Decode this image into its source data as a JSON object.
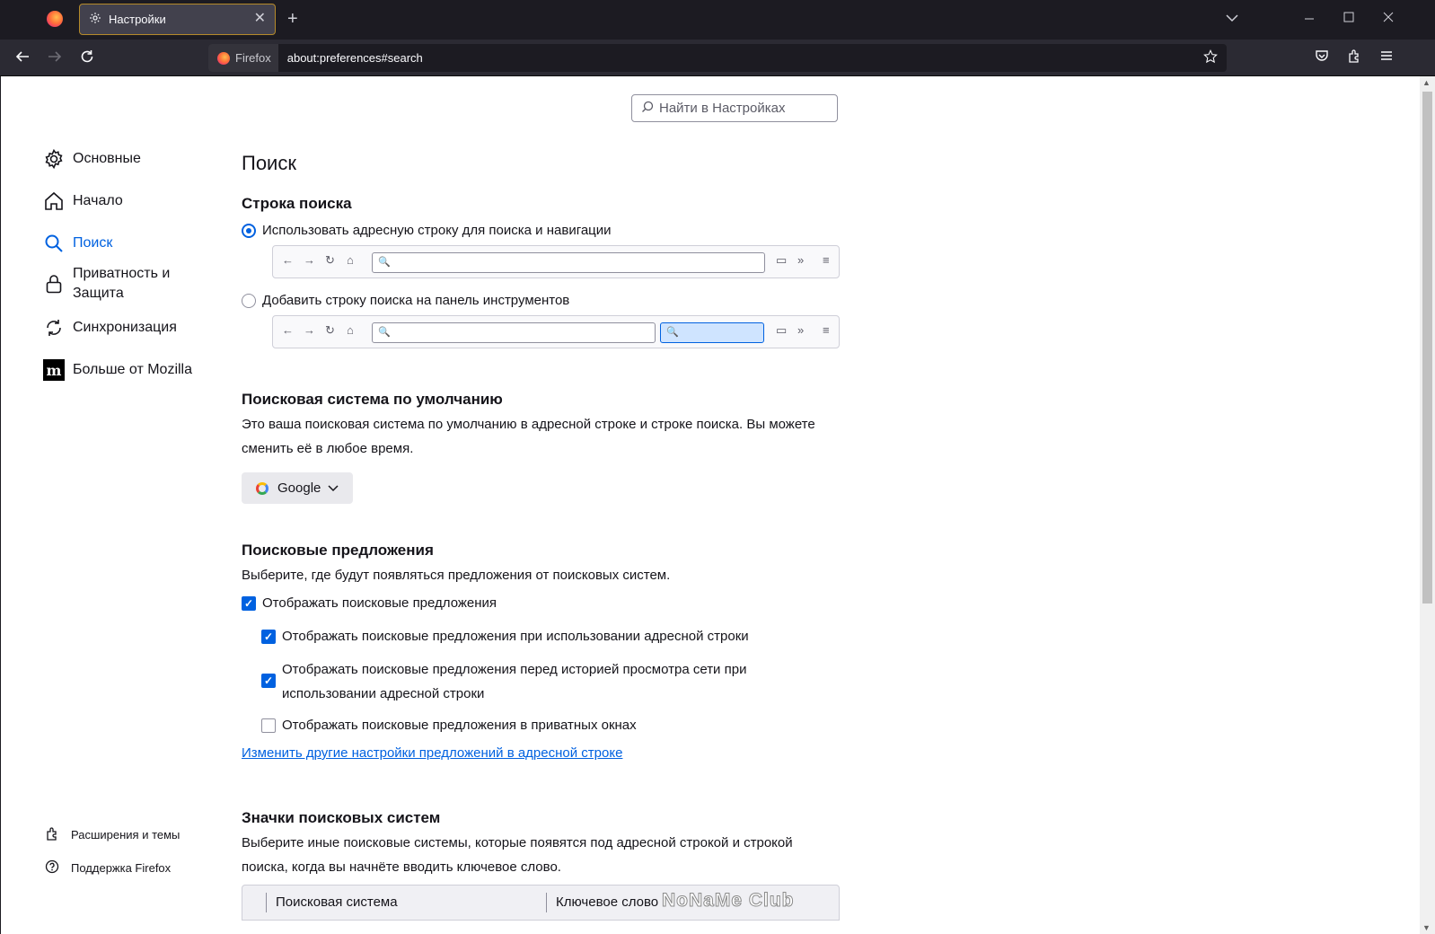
{
  "window": {
    "tab_title": "Настройки",
    "tab_close": "✕",
    "new_tab": "+"
  },
  "navbar": {
    "identity_label": "Firefox",
    "url": "about:preferences#search"
  },
  "search": {
    "placeholder": "Найти в Настройках"
  },
  "sidebar": {
    "items": [
      {
        "label": "Основные"
      },
      {
        "label": "Начало"
      },
      {
        "label": "Поиск"
      },
      {
        "label": "Приватность и Защита"
      },
      {
        "label": "Синхронизация"
      },
      {
        "label": "Больше от Mozilla"
      }
    ],
    "bottom": [
      {
        "label": "Расширения и темы"
      },
      {
        "label": "Поддержка Firefox"
      }
    ]
  },
  "main": {
    "page_title": "Поиск",
    "search_bar": {
      "heading": "Строка поиска",
      "option_urlbar": "Использовать адресную строку для поиска и навигации",
      "option_searchbar": "Добавить строку поиска на панель инструментов",
      "selected": "urlbar"
    },
    "default_engine": {
      "heading": "Поисковая система по умолчанию",
      "description": "Это ваша поисковая система по умолчанию в адресной строке и строке поиска. Вы можете сменить её в любое время.",
      "selected": "Google"
    },
    "suggestions": {
      "heading": "Поисковые предложения",
      "description": "Выберите, где будут появляться предложения от поисковых систем.",
      "items": [
        {
          "label": "Отображать поисковые предложения",
          "checked": true
        },
        {
          "label": "Отображать поисковые предложения при использовании адресной строки",
          "checked": true
        },
        {
          "label": "Отображать поисковые предложения перед историей просмотра сети при использовании адресной строки",
          "checked": true
        },
        {
          "label": "Отображать поисковые предложения в приватных окнах",
          "checked": false
        }
      ],
      "link": "Изменить другие настройки предложений в адресной строке"
    },
    "shortcuts": {
      "heading": "Значки поисковых систем",
      "description": "Выберите иные поисковые системы, которые появятся под адресной строкой и строкой поиска, когда вы начнёте вводить ключевое слово.",
      "columns": [
        "Поисковая система",
        "Ключевое слово"
      ]
    }
  },
  "watermark": "NoNaMe Club",
  "colors": {
    "accent": "#0061e0",
    "chrome_dark": "#1c1b22",
    "toolbar": "#2b2a33"
  }
}
